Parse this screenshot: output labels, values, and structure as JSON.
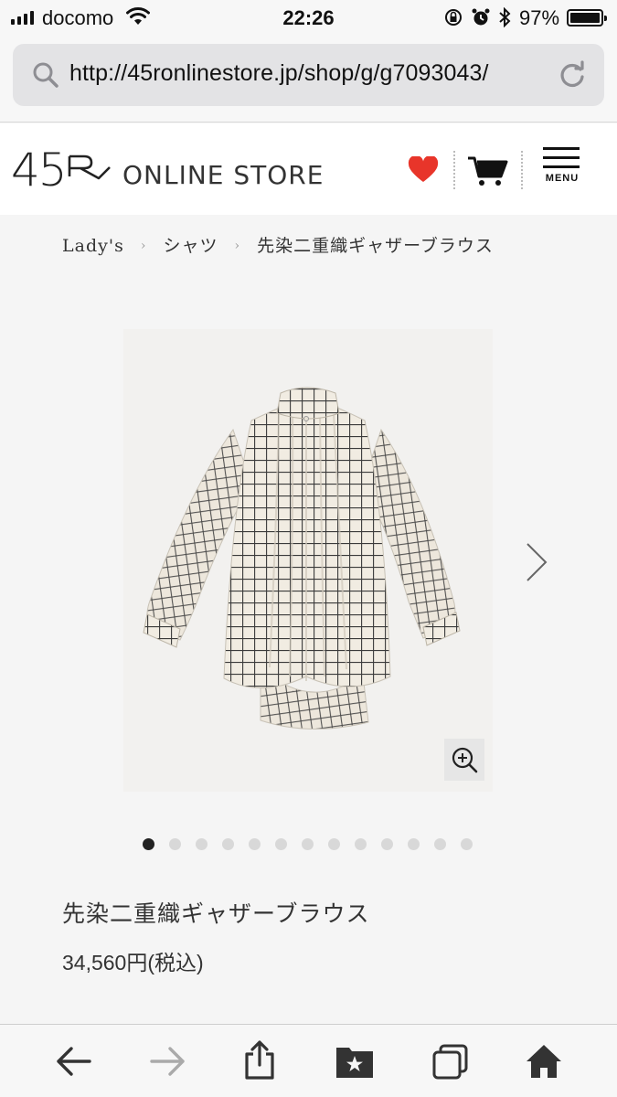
{
  "status_bar": {
    "carrier": "docomo",
    "time": "22:26",
    "battery": "97%"
  },
  "browser": {
    "url": "http://45ronlinestore.jp/shop/g/g7093043/"
  },
  "header": {
    "logo_text": "45R",
    "logo_sub": "ONLINE STORE",
    "menu_label": "MENU"
  },
  "breadcrumb": [
    "Lady's",
    "シャツ",
    "先染二重織ギャザーブラウス"
  ],
  "product": {
    "title": "先染二重織ギャザーブラウス",
    "price": "34,560円(税込)",
    "image_count": 13,
    "active_image": 1
  },
  "colors": {
    "heart": "#e8352a",
    "accent": "#111111"
  }
}
